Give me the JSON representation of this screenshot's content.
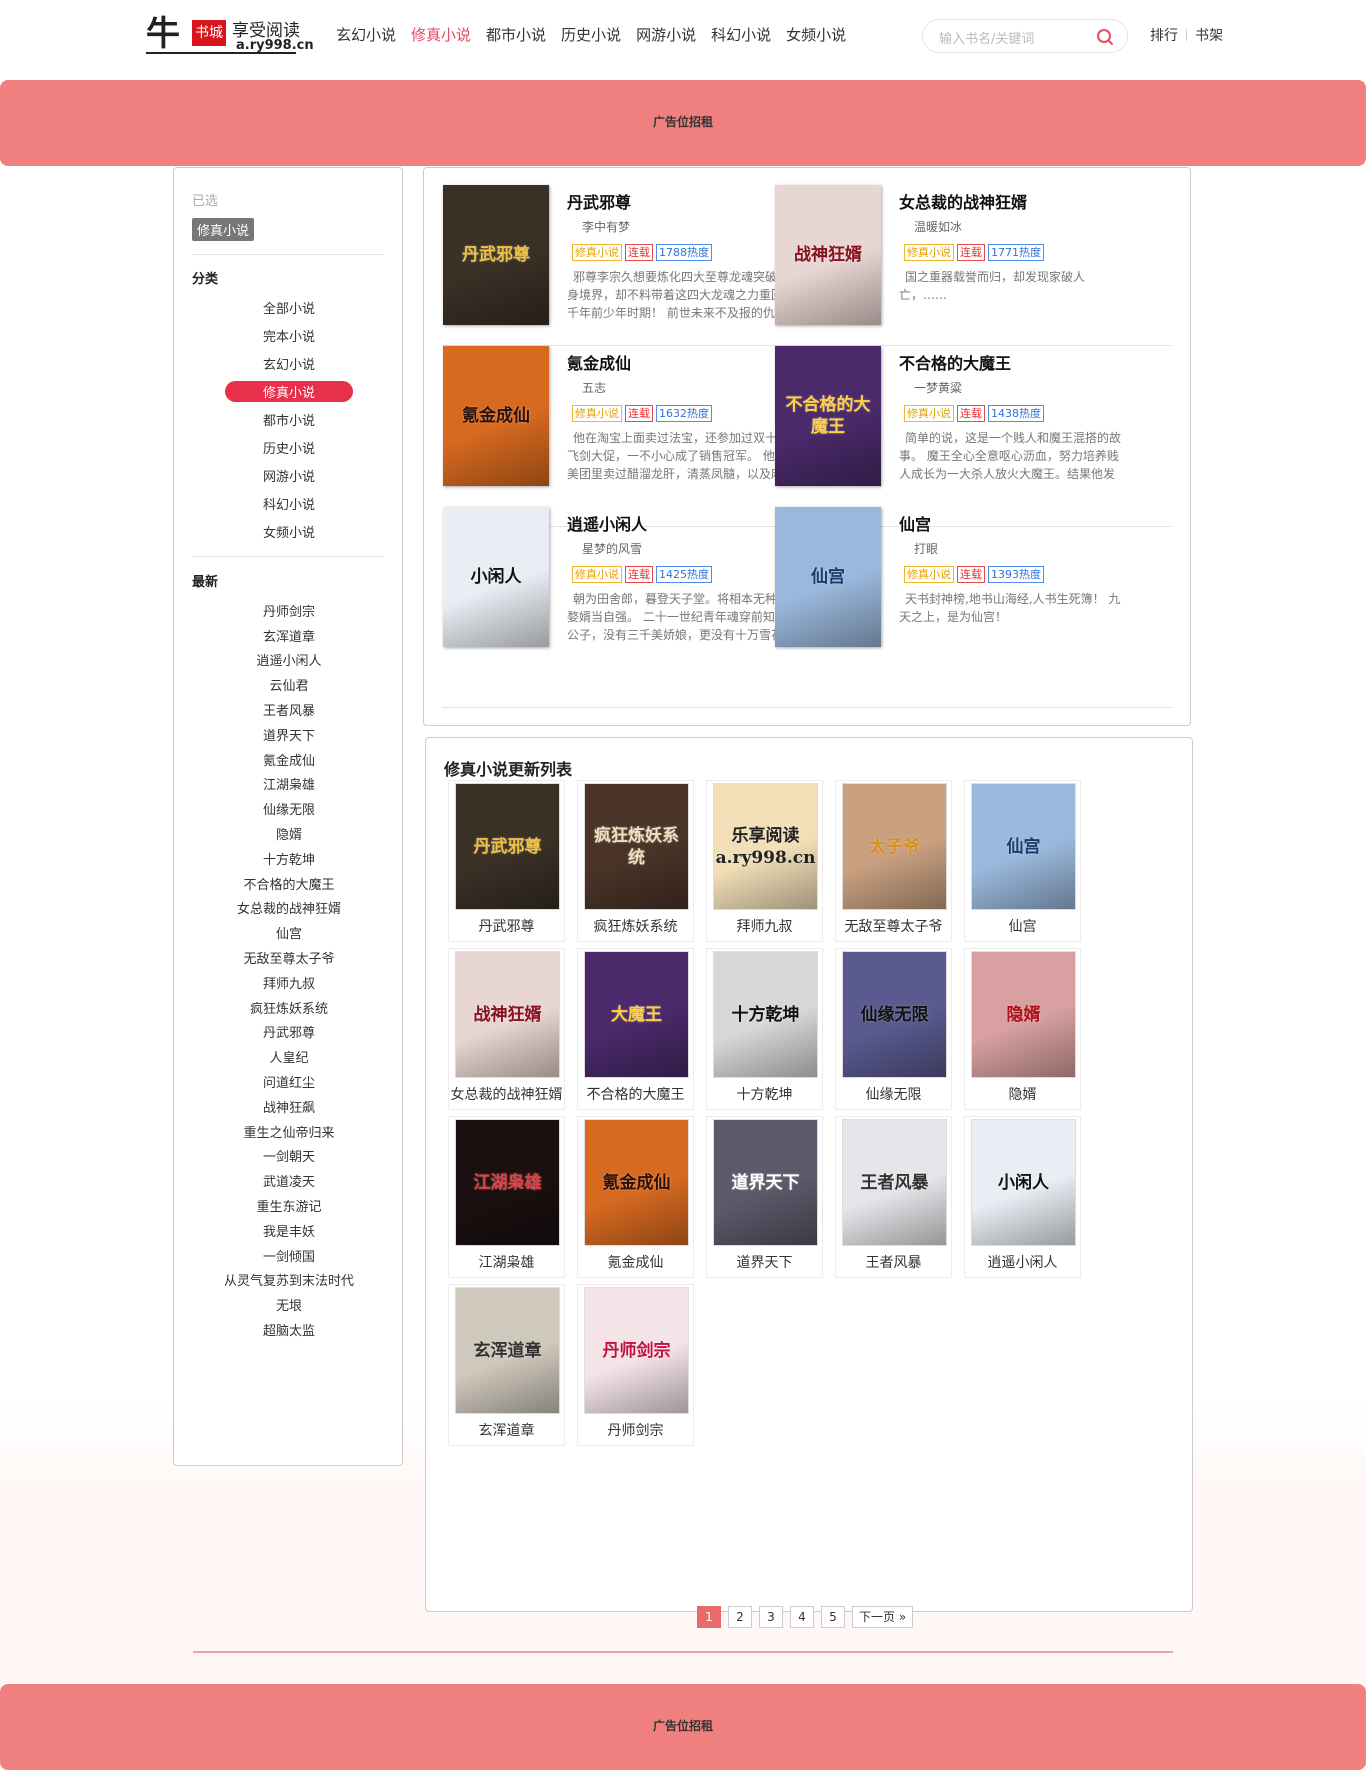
{
  "logo": {
    "char": "牛",
    "stamp": "书城",
    "slogan": "享受阅读",
    "domain": "a.ry998.cn"
  },
  "nav": [
    {
      "label": "玄幻小说",
      "active": false
    },
    {
      "label": "修真小说",
      "active": true
    },
    {
      "label": "都市小说",
      "active": false
    },
    {
      "label": "历史小说",
      "active": false
    },
    {
      "label": "网游小说",
      "active": false
    },
    {
      "label": "科幻小说",
      "active": false
    },
    {
      "label": "女频小说",
      "active": false
    }
  ],
  "search": {
    "placeholder": "输入书名/关键词",
    "icon": "search-icon"
  },
  "top_links": {
    "rank": "排行",
    "shelf": "书架"
  },
  "ads": {
    "top": "广告位招租",
    "bottom": "广告位招租"
  },
  "sidebar": {
    "selected_label": "已选",
    "selected_value": "修真小说",
    "category_head": "分类",
    "categories": [
      "全部小说",
      "完本小说",
      "玄幻小说",
      "修真小说",
      "都市小说",
      "历史小说",
      "网游小说",
      "科幻小说",
      "女频小说"
    ],
    "active_category": "修真小说",
    "latest_head": "最新",
    "latest": [
      "丹师剑宗",
      "玄浑道章",
      "逍遥小闲人",
      "云仙君",
      "王者风暴",
      "道界天下",
      "氪金成仙",
      "江湖枭雄",
      "仙缘无限",
      "隐婿",
      "十方乾坤",
      "不合格的大魔王",
      "女总裁的战神狂婿",
      "仙宫",
      "无敌至尊太子爷",
      "拜师九叔",
      "疯狂炼妖系统",
      "丹武邪尊",
      "人皇纪",
      "问道红尘",
      "战神狂飙",
      "重生之仙帝归来",
      "一剑朝天",
      "武道凌天",
      "重生东游记",
      "我是丰妖",
      "一剑倾国",
      "从灵气复苏到末法时代",
      "无垠",
      "超脑太监"
    ]
  },
  "featured": [
    {
      "title": "丹武邪尊",
      "author": "李中有梦",
      "category": "修真小说",
      "status": "连载",
      "hot": "1788热度",
      "desc": "邪尊李宗久想要炼化四大至尊龙魂突破自身境界，却不料带着这四大龙魂之力重回三千年前少年时期！ 前世未来不及报的仇，这",
      "cover_bg": "#3a3026",
      "cover_text": "丹武邪尊",
      "cover_text_color": "#f0c040"
    },
    {
      "title": "女总裁的战神狂婿",
      "author": "温暖如冰",
      "category": "修真小说",
      "status": "连载",
      "hot": "1771热度",
      "desc": "国之重器载誉而归，却发现家破人亡，……",
      "cover_bg": "#e8d6d2",
      "cover_text": "战神狂婿",
      "cover_text_color": "#8a1020"
    },
    {
      "title": "氪金成仙",
      "author": "五志",
      "category": "修真小说",
      "status": "连载",
      "hot": "1632热度",
      "desc": "他在淘宝上面卖过法宝，还参加过双十一飞剑大促，一不小心成了销售冠军。 他在美团里卖过醋溜龙肝，清蒸凤髓，以及麻辣",
      "cover_bg": "#d86a20",
      "cover_text": "氪金成仙",
      "cover_text_color": "#2a1008"
    },
    {
      "title": "不合格的大魔王",
      "author": "一梦黄粱",
      "category": "修真小说",
      "status": "连载",
      "hot": "1438热度",
      "desc": "简单的说，这是一个贱人和魔王混搭的故事。 魔王全心全意呕心沥血，努力培养贱人成长为一大杀人放火大魔王。结果他发",
      "cover_bg": "#4a2a6a",
      "cover_text": "不合格的大魔王",
      "cover_text_color": "#ffd040"
    },
    {
      "title": "逍遥小闲人",
      "author": "星梦的风雪",
      "category": "修真小说",
      "status": "连载",
      "hot": "1425热度",
      "desc": "朝为田舍郎，暮登天子堂。将相本无种，婺婿当自强。 二十一世纪青年魂穿前知县公子，没有三千美娇娘，更没有十万雪花",
      "cover_bg": "#e8eef4",
      "cover_text": "小闲人",
      "cover_text_color": "#111"
    },
    {
      "title": "仙宫",
      "author": "打眼",
      "category": "修真小说",
      "status": "连载",
      "hot": "1393热度",
      "desc": "天书封神榜,地书山海经,人书生死簿！ 九天之上，是为仙宫！",
      "cover_bg": "#9ab8dc",
      "cover_text": "仙宫",
      "cover_text_color": "#1a3a6a"
    }
  ],
  "updates": {
    "title": "修真小说更新列表",
    "books": [
      {
        "name": "丹武邪尊",
        "cover_bg": "#3a3026",
        "cover_text": "丹武邪尊",
        "cover_text_color": "#f0c040"
      },
      {
        "name": "疯狂炼妖系统",
        "cover_bg": "#4a3428",
        "cover_text": "疯狂炼妖系统",
        "cover_text_color": "#f0e0c0"
      },
      {
        "name": "拜师九叔",
        "cover_bg": "#f2dfb8",
        "cover_text": "乐享阅读 a.ry998.cn",
        "cover_text_color": "#222"
      },
      {
        "name": "无敌至尊太子爷",
        "cover_bg": "#c8a080",
        "cover_text": "太子爷",
        "cover_text_color": "#d89020"
      },
      {
        "name": "仙宫",
        "cover_bg": "#9ab8dc",
        "cover_text": "仙宫",
        "cover_text_color": "#1a3a6a"
      },
      {
        "name": "女总裁的战神狂婿",
        "cover_bg": "#e8d6d2",
        "cover_text": "战神狂婿",
        "cover_text_color": "#8a1020"
      },
      {
        "name": "不合格的大魔王",
        "cover_bg": "#4a2a6a",
        "cover_text": "大魔王",
        "cover_text_color": "#ffd040"
      },
      {
        "name": "十方乾坤",
        "cover_bg": "#d8d8d8",
        "cover_text": "十方乾坤",
        "cover_text_color": "#111"
      },
      {
        "name": "仙缘无限",
        "cover_bg": "#5a5a90",
        "cover_text": "仙缘无限",
        "cover_text_color": "#111"
      },
      {
        "name": "隐婿",
        "cover_bg": "#d8a0a0",
        "cover_text": "隐婿",
        "cover_text_color": "#b01018"
      },
      {
        "name": "江湖枭雄",
        "cover_bg": "#1a1010",
        "cover_text": "江湖枭雄",
        "cover_text_color": "#e84040"
      },
      {
        "name": "氪金成仙",
        "cover_bg": "#d86a20",
        "cover_text": "氪金成仙",
        "cover_text_color": "#2a1008"
      },
      {
        "name": "道界天下",
        "cover_bg": "#5a5a6a",
        "cover_text": "道界天下",
        "cover_text_color": "#fff"
      },
      {
        "name": "王者风暴",
        "cover_bg": "#e6e6ea",
        "cover_text": "王者风暴",
        "cover_text_color": "#333"
      },
      {
        "name": "逍遥小闲人",
        "cover_bg": "#e8eef4",
        "cover_text": "小闲人",
        "cover_text_color": "#111"
      },
      {
        "name": "玄浑道章",
        "cover_bg": "#cfc8bc",
        "cover_text": "玄浑道章",
        "cover_text_color": "#333"
      },
      {
        "name": "丹师剑宗",
        "cover_bg": "#f4e4e8",
        "cover_text": "丹师剑宗",
        "cover_text_color": "#c01040"
      }
    ]
  },
  "pager": {
    "pages": [
      "1",
      "2",
      "3",
      "4",
      "5"
    ],
    "current": "1",
    "next": "下一页 »"
  },
  "colors": {
    "accent": "#e8475e",
    "ad_bg": "#f08080",
    "active_pill": "#e8304a"
  }
}
